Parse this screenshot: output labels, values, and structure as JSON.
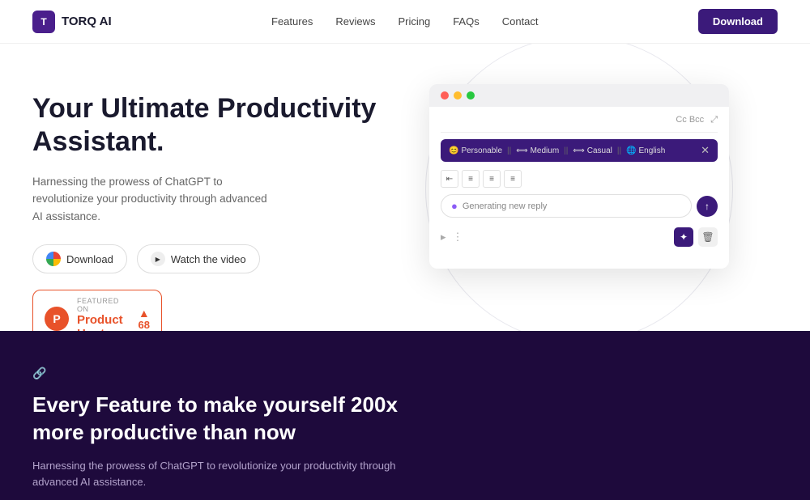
{
  "nav": {
    "logo_icon": "T",
    "logo_text": "TORQ AI",
    "links": [
      "Features",
      "Reviews",
      "Pricing",
      "FAQs",
      "Contact"
    ],
    "download_btn": "Download"
  },
  "hero": {
    "title": "Your Ultimate Productivity Assistant.",
    "description": "Harnessing the prowess of ChatGPT to revolutionize your productivity through advanced AI assistance.",
    "download_btn": "Download",
    "video_btn": "Watch the video",
    "ph_featured": "FEATURED ON",
    "ph_name": "Product Hunt",
    "ph_count": "68"
  },
  "browser": {
    "cc_bcc": "Cc  Bcc",
    "toolbar_items": [
      "Personable",
      "Medium",
      "Casual",
      "English"
    ],
    "generating": "Generating new reply",
    "editor_tools": [
      "≡",
      "≡",
      "≡",
      "≡"
    ]
  },
  "bottom": {
    "heading": "Every Feature to make yourself 200x more productive than now",
    "description": "Harnessing the prowess of ChatGPT to revolutionize your productivity through advanced AI assistance."
  }
}
